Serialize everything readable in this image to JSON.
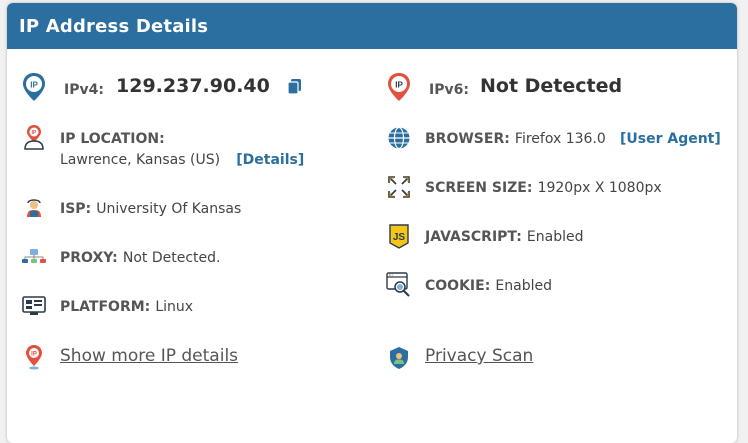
{
  "header": {
    "title": "IP Address Details"
  },
  "left": {
    "ipv4": {
      "label": "IPv4:",
      "value": "129.237.90.40",
      "icon": "ip-pin-icon",
      "copy_icon": "copy-icon"
    },
    "location": {
      "label": "IP LOCATION:",
      "value": "Lawrence, Kansas (US)",
      "link": "[Details]",
      "icon": "location-person-icon"
    },
    "isp": {
      "label": "ISP:",
      "value": "University Of Kansas",
      "icon": "isp-icon"
    },
    "proxy": {
      "label": "PROXY:",
      "value": "Not Detected.",
      "icon": "proxy-icon"
    },
    "platform": {
      "label": "PLATFORM:",
      "value": "Linux",
      "icon": "platform-icon"
    },
    "more": {
      "label": "Show more IP details",
      "icon": "ip-pin-small-icon"
    }
  },
  "right": {
    "ipv6": {
      "label": "IPv6:",
      "value": "Not Detected",
      "icon": "ip-pin-red-icon"
    },
    "browser": {
      "label": "BROWSER:",
      "value": "Firefox 136.0",
      "link": "[User Agent]",
      "icon": "globe-icon"
    },
    "screen": {
      "label": "SCREEN SIZE:",
      "value": "1920px X 1080px",
      "icon": "expand-arrows-icon"
    },
    "javascript": {
      "label": "JAVASCRIPT:",
      "value": "Enabled",
      "icon": "javascript-icon"
    },
    "cookie": {
      "label": "COOKIE:",
      "value": "Enabled",
      "icon": "cookie-search-icon"
    },
    "privacy": {
      "label": "Privacy Scan",
      "icon": "shield-user-icon"
    }
  },
  "colors": {
    "header_bg": "#2a6fa0",
    "link": "#2a6fa0",
    "pin_blue": "#2a6fa0",
    "pin_red": "#e2513e"
  }
}
